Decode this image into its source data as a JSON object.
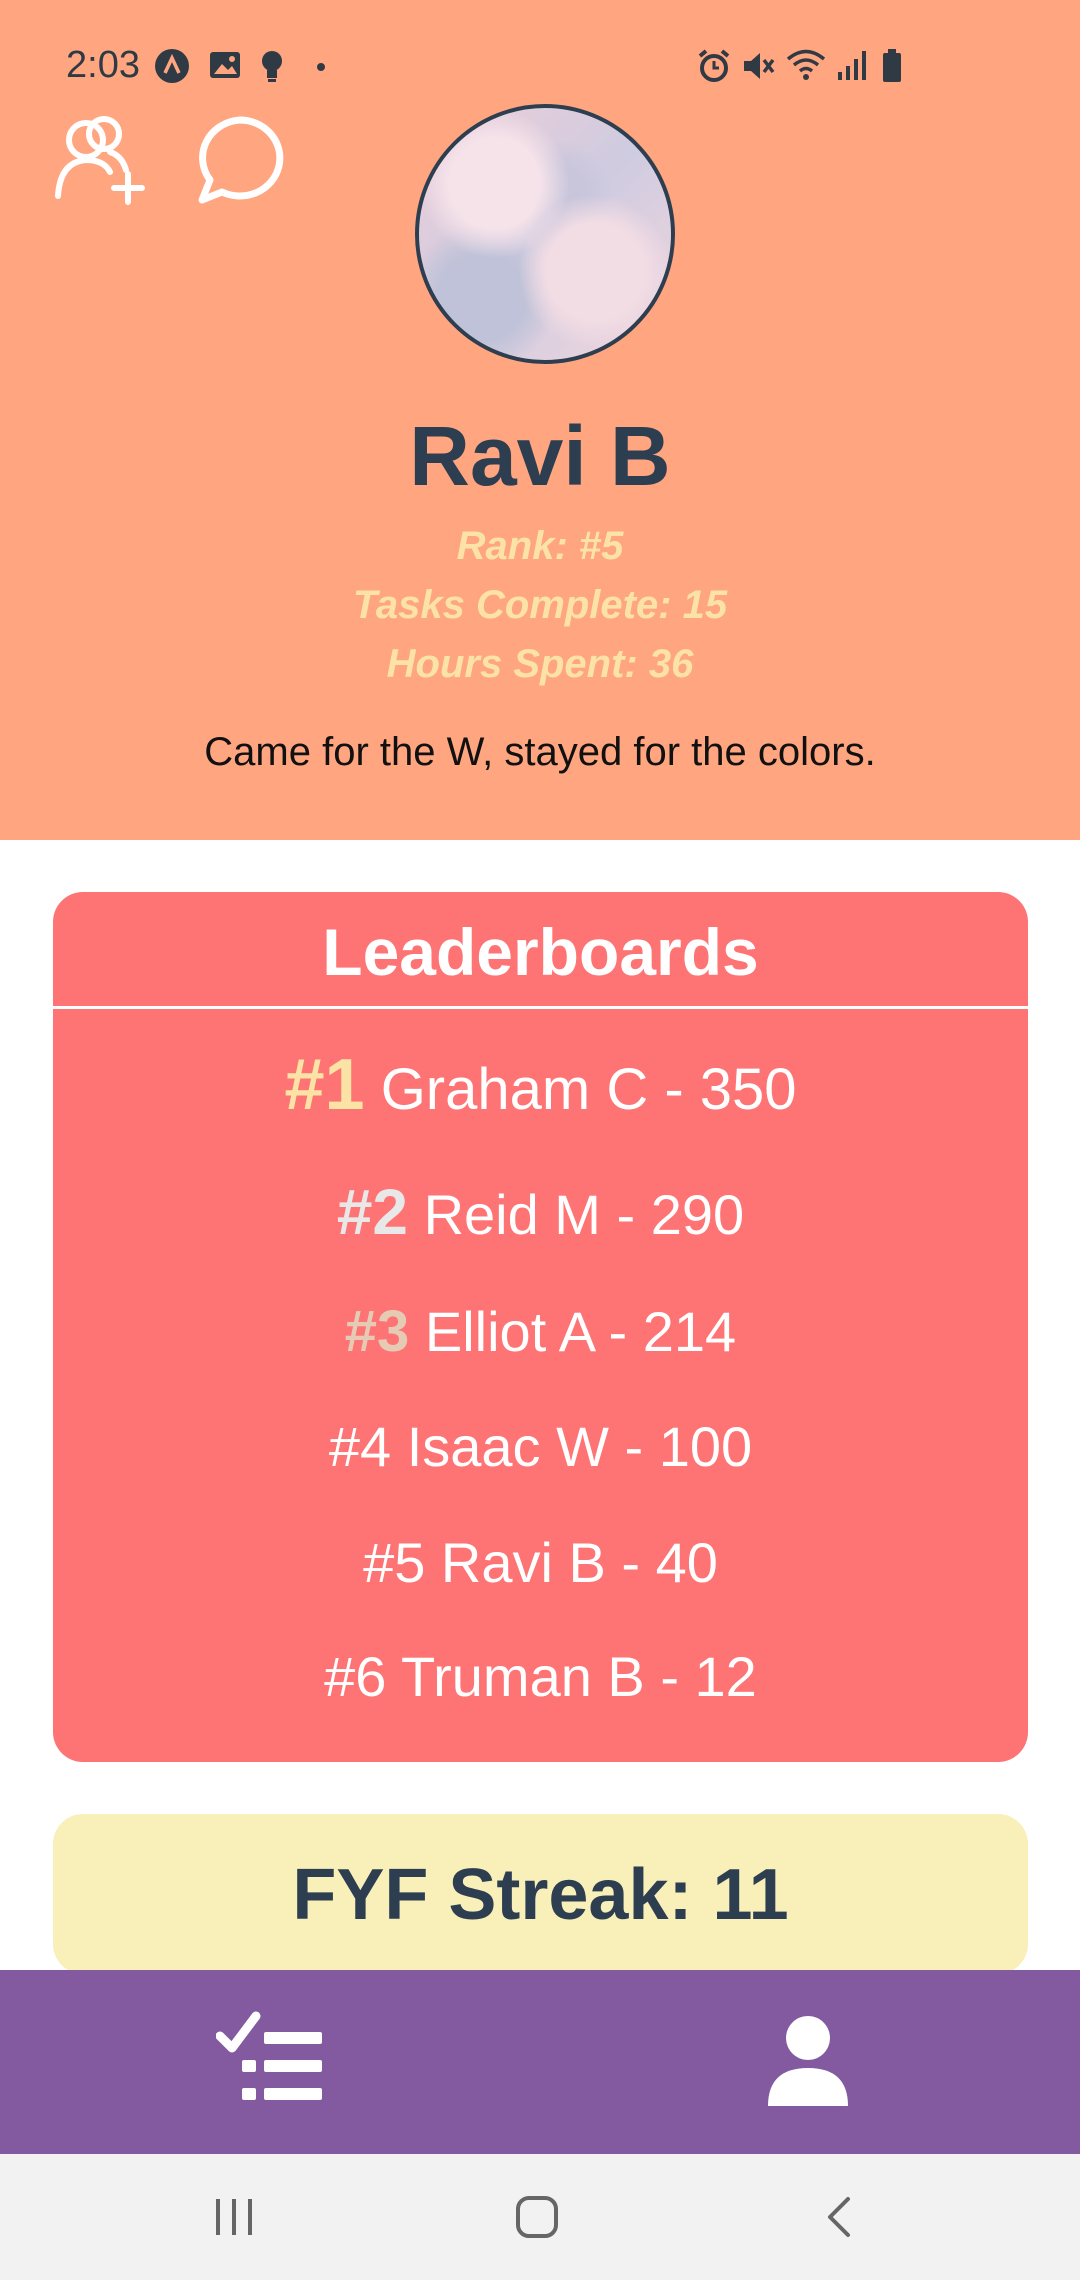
{
  "status_bar": {
    "time": "2:03",
    "left_icons": [
      "app-a-icon",
      "image-icon",
      "bulb-icon",
      "dot-icon"
    ],
    "right_icons": [
      "alarm-icon",
      "mute-icon",
      "wifi-icon",
      "signal-icon",
      "battery-icon"
    ]
  },
  "header": {
    "bg_color": "#ffa57f",
    "left_actions": [
      "add-friend-icon",
      "chat-icon"
    ]
  },
  "profile": {
    "name": "Ravi B",
    "rank": "Rank: #5",
    "tasks": "Tasks Complete: 15",
    "hours": "Hours Spent: 36",
    "bio": "Came for the W, stayed for the colors."
  },
  "leaderboard": {
    "title": "Leaderboards",
    "bg_color": "#fe7374",
    "entries": [
      {
        "rank": "#1",
        "text": "Graham C - 350",
        "rank_color": "#fbe3a6"
      },
      {
        "rank": "#2",
        "text": "Reid M - 290",
        "rank_color": "#e8e8e8"
      },
      {
        "rank": "#3",
        "text": "Elliot A - 214",
        "rank_color": "#e6cbb4"
      },
      {
        "rank": "#4",
        "text": "Isaac W - 100",
        "rank_color": "#ffffff"
      },
      {
        "rank": "#5",
        "text": "Ravi B - 40",
        "rank_color": "#ffffff"
      },
      {
        "rank": "#6",
        "text": "Truman B - 12",
        "rank_color": "#ffffff"
      }
    ]
  },
  "streak": {
    "text": "FYF Streak: 11",
    "bg_color": "#f9efb9"
  },
  "tab_bar": {
    "bg_color": "#8359a0",
    "tabs": [
      {
        "name": "tasks",
        "icon": "checklist-icon"
      },
      {
        "name": "profile",
        "icon": "person-icon"
      }
    ]
  },
  "nav_bar": {
    "buttons": [
      "recents-icon",
      "home-icon",
      "back-icon"
    ]
  }
}
